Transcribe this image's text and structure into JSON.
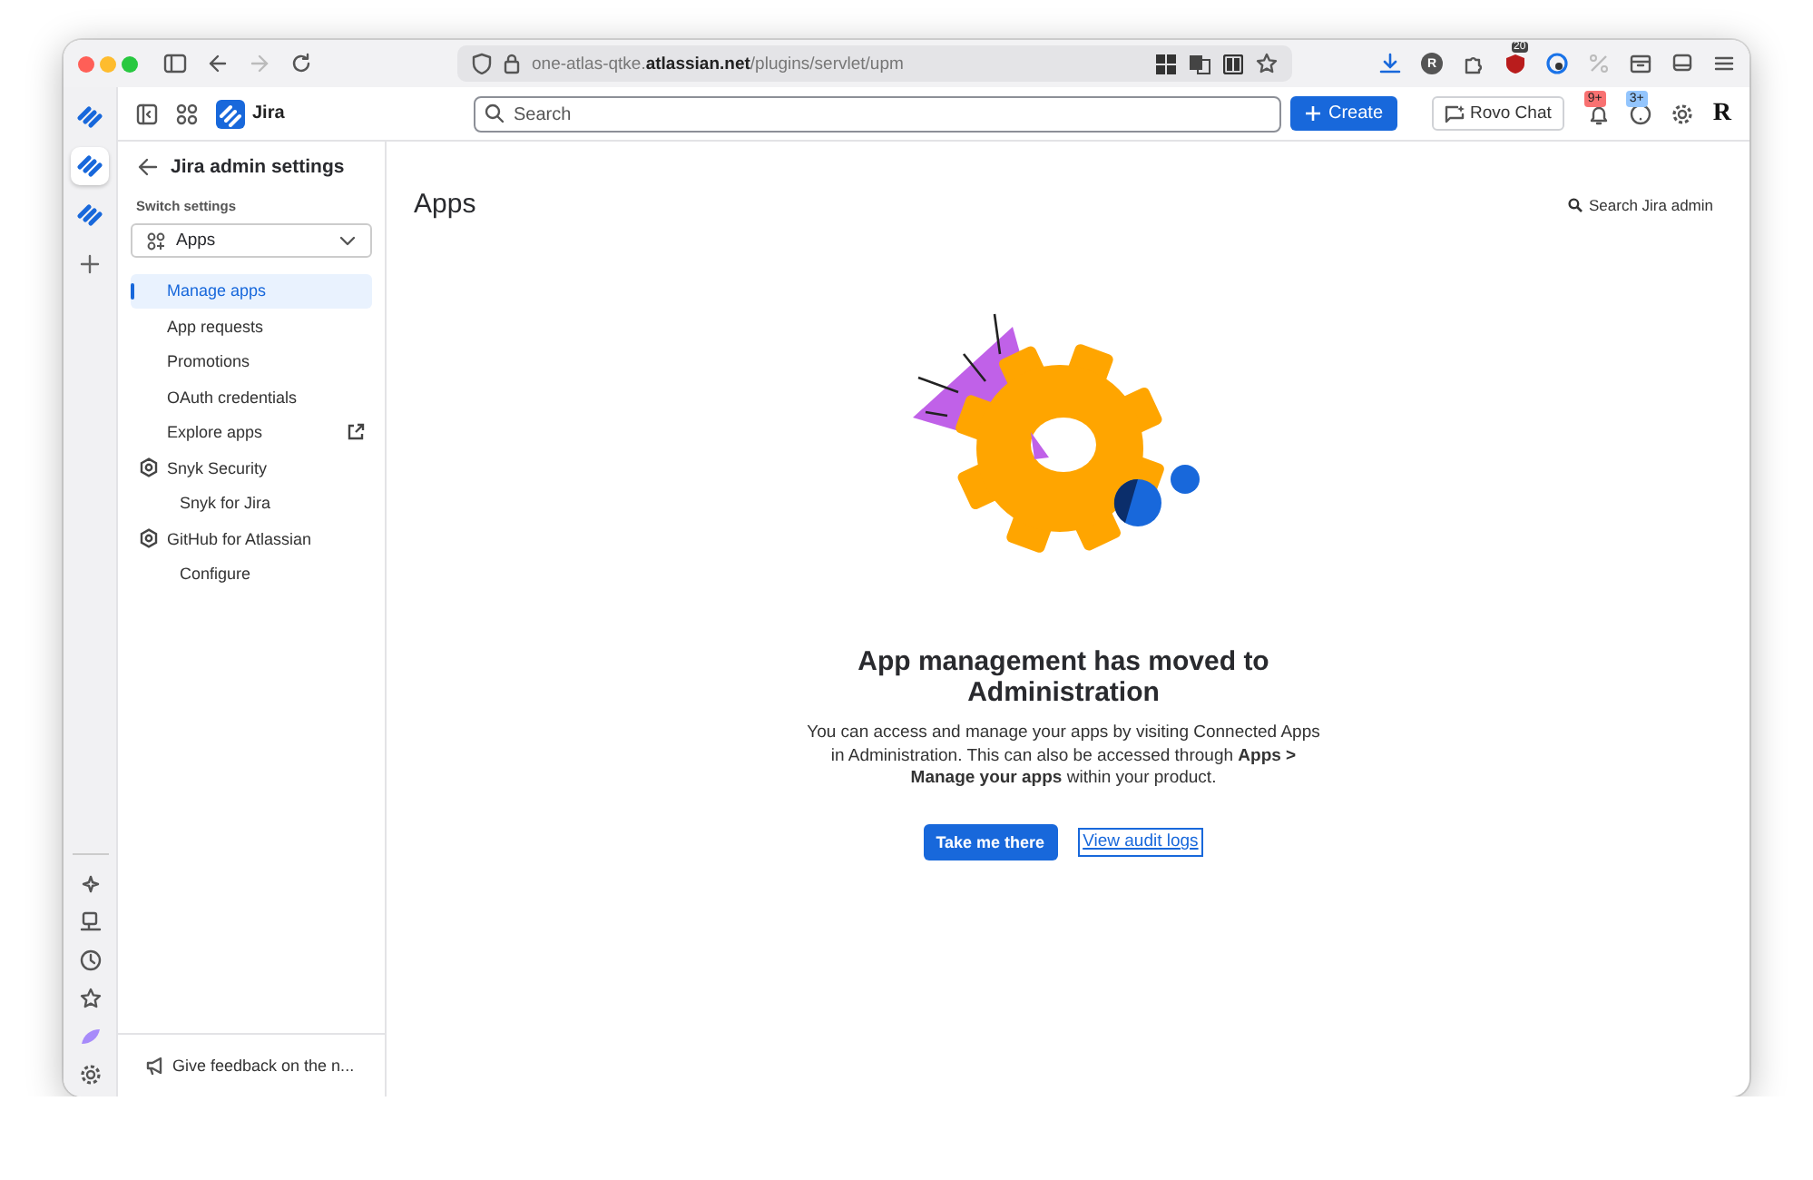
{
  "browser": {
    "url_prefix": "one-atlas-qtke.",
    "url_domain": "atlassian.net",
    "url_path": "/plugins/servlet/upm",
    "extension_badge": "20",
    "profile_initial": "R"
  },
  "topbar": {
    "product": "Jira",
    "search_placeholder": "Search",
    "create_label": "Create",
    "rovo_label": "Rovo Chat",
    "notifications_badge": "9+",
    "help_badge": "3+",
    "avatar_initial": "R"
  },
  "rail": {
    "items": [
      {
        "kind": "jira",
        "selected": false
      },
      {
        "kind": "jira",
        "selected": true
      },
      {
        "kind": "jira",
        "selected": false
      },
      {
        "kind": "add",
        "selected": false
      }
    ]
  },
  "sidebar": {
    "title": "Jira admin settings",
    "switch_label": "Switch settings",
    "switch_value": "Apps",
    "items": [
      {
        "kind": "link",
        "label": "Manage apps",
        "selected": true
      },
      {
        "kind": "link",
        "label": "App requests",
        "selected": false
      },
      {
        "kind": "link",
        "label": "Promotions",
        "selected": false
      },
      {
        "kind": "link",
        "label": "OAuth credentials",
        "selected": false
      },
      {
        "kind": "external",
        "label": "Explore apps",
        "selected": false
      },
      {
        "kind": "group",
        "label": "Snyk Security",
        "selected": false,
        "children": [
          {
            "label": "Snyk for Jira",
            "selected": false
          }
        ]
      },
      {
        "kind": "group",
        "label": "GitHub for Atlassian",
        "selected": false,
        "children": [
          {
            "label": "Configure",
            "selected": false
          }
        ]
      }
    ],
    "feedback": "Give feedback on the n..."
  },
  "main": {
    "title": "Apps",
    "search_link": "Search Jira admin",
    "heading": "App management has moved to Administration",
    "body": "You can access and manage your apps by visiting Connected Apps in Administration. This can also be accessed through **Apps > Manage your apps** within your product.",
    "primary_button": "Take me there",
    "secondary_button": "View audit logs"
  }
}
